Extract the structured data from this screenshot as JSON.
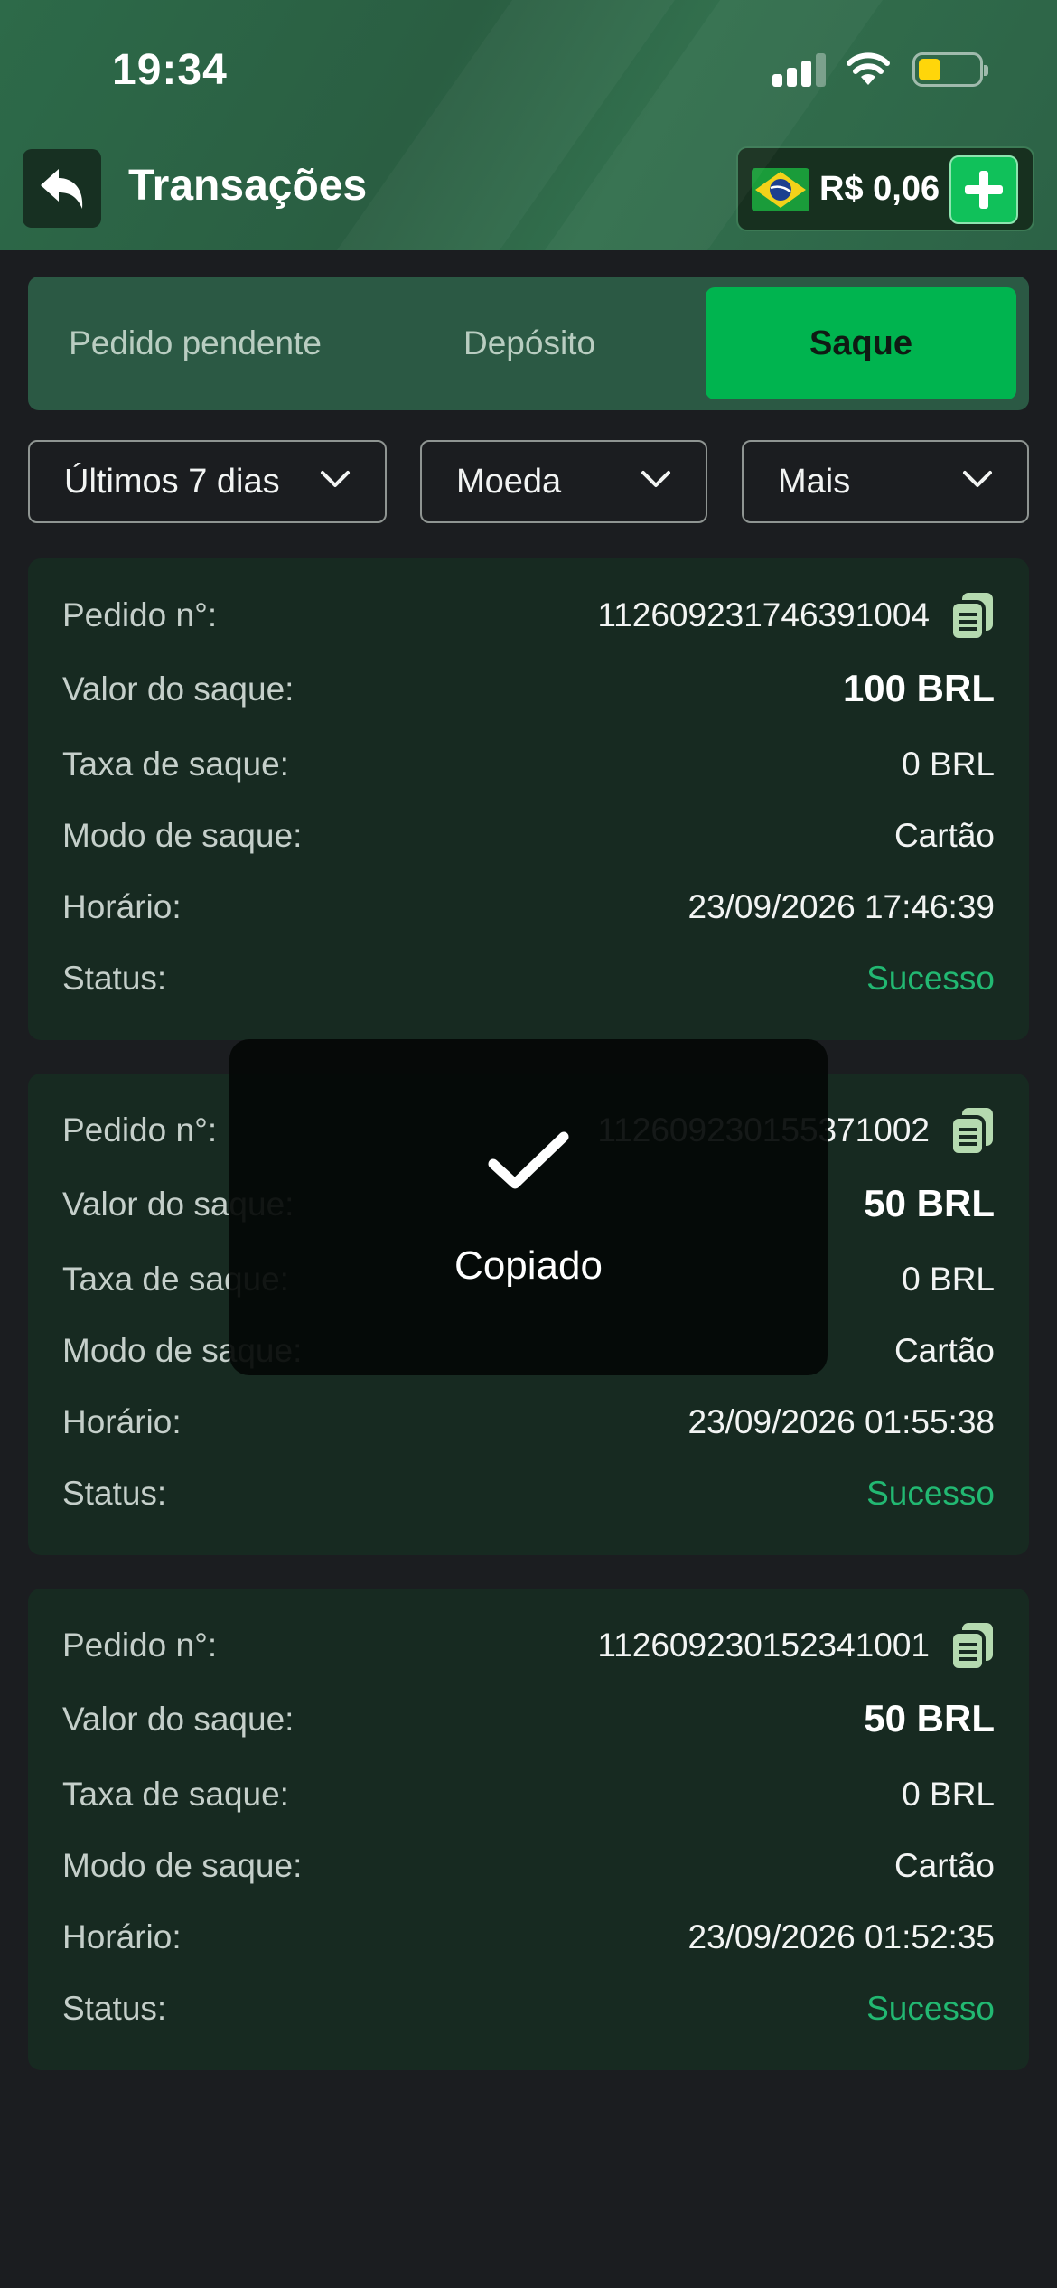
{
  "status_bar": {
    "time": "19:34"
  },
  "header": {
    "title": "Transações",
    "balance": "R$ 0,06"
  },
  "tabs": [
    {
      "label": "Pedido pendente",
      "active": false
    },
    {
      "label": "Depósito",
      "active": false
    },
    {
      "label": "Saque",
      "active": true
    }
  ],
  "filters": [
    {
      "label": "Últimos 7 dias"
    },
    {
      "label": "Moeda"
    },
    {
      "label": "Mais"
    }
  ],
  "labels": {
    "order": "Pedido n°:",
    "amount": "Valor do saque:",
    "fee": "Taxa de saque:",
    "mode": "Modo de saque:",
    "time": "Horário:",
    "status": "Status:"
  },
  "transactions": [
    {
      "order": "112609231746391004",
      "amount": "100 BRL",
      "fee": "0 BRL",
      "mode": "Cartão",
      "time": "23/09/2026 17:46:39",
      "status": "Sucesso"
    },
    {
      "order": "112609230155371002",
      "amount": "50 BRL",
      "fee": "0 BRL",
      "mode": "Cartão",
      "time": "23/09/2026 01:55:38",
      "status": "Sucesso"
    },
    {
      "order": "112609230152341001",
      "amount": "50 BRL",
      "fee": "0 BRL",
      "mode": "Cartão",
      "time": "23/09/2026 01:52:35",
      "status": "Sucesso"
    }
  ],
  "toast": {
    "message": "Copiado"
  },
  "colors": {
    "accent": "#00b44f",
    "success": "#22b872",
    "background": "#1b1d20",
    "card": "#172a21"
  }
}
